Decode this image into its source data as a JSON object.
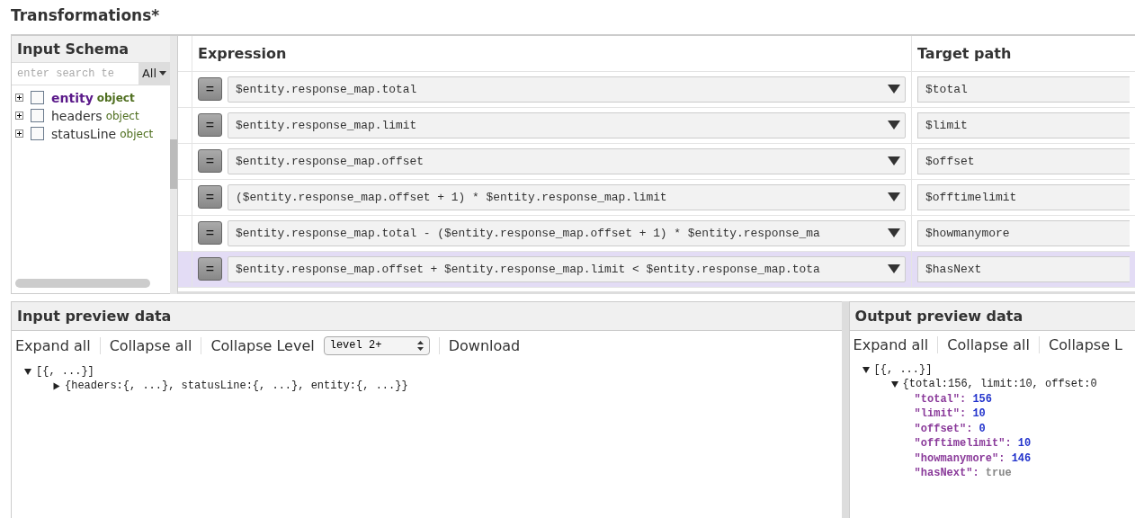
{
  "title": "Transformations*",
  "schema": {
    "heading": "Input Schema",
    "search": {
      "placeholder": "enter search te"
    },
    "filter": "All",
    "items": [
      {
        "name": "entity",
        "type": "object",
        "selected": true,
        "checked": false
      },
      {
        "name": "headers",
        "type": "object",
        "selected": false,
        "checked": false
      },
      {
        "name": "statusLine",
        "type": "object",
        "selected": false,
        "checked": false
      }
    ]
  },
  "table": {
    "columns": [
      "Expression",
      "Target path"
    ],
    "rows": [
      {
        "operator": "=",
        "expression": "$entity.response_map.total",
        "target": "$total",
        "selected": false
      },
      {
        "operator": "=",
        "expression": "$entity.response_map.limit",
        "target": "$limit",
        "selected": false
      },
      {
        "operator": "=",
        "expression": "$entity.response_map.offset",
        "target": "$offset",
        "selected": false
      },
      {
        "operator": "=",
        "expression": "($entity.response_map.offset + 1) * $entity.response_map.limit",
        "target": "$offtimelimit",
        "selected": false
      },
      {
        "operator": "=",
        "expression": "$entity.response_map.total - ($entity.response_map.offset + 1) * $entity.response_ma",
        "target": "$howmanymore",
        "selected": false
      },
      {
        "operator": "=",
        "expression": "$entity.response_map.offset + $entity.response_map.limit < $entity.response_map.tota",
        "target": "$hasNext",
        "selected": true
      }
    ]
  },
  "input_preview": {
    "heading": "Input preview data",
    "toolbar": [
      "Expand all",
      "Collapse all",
      "Collapse Level"
    ],
    "level_select": "level 2+",
    "download": "Download",
    "tree": [
      {
        "text": "[{, ...}]",
        "expanded": true,
        "children": [
          {
            "text": "{headers:{, ...}, statusLine:{, ...}, entity:{, ...}}",
            "expanded": false
          }
        ]
      }
    ]
  },
  "output_preview": {
    "heading": "Output preview data",
    "toolbar": [
      "Expand all",
      "Collapse all",
      "Collapse L"
    ],
    "tree": [
      {
        "text": "[{, ...}]",
        "expanded": true,
        "children": [
          {
            "text": "{total:156, limit:10, offset:0",
            "expanded": true,
            "fields": [
              {
                "key": "\"total\":",
                "value": "156",
                "kind": "number"
              },
              {
                "key": "\"limit\":",
                "value": "10",
                "kind": "number"
              },
              {
                "key": "\"offset\":",
                "value": "0",
                "kind": "number"
              },
              {
                "key": "\"offtimelimit\":",
                "value": "10",
                "kind": "number"
              },
              {
                "key": "\"howmanymore\":",
                "value": "146",
                "kind": "number"
              },
              {
                "key": "\"hasNext\":",
                "value": "true",
                "kind": "boolean"
              }
            ]
          }
        ]
      }
    ]
  }
}
